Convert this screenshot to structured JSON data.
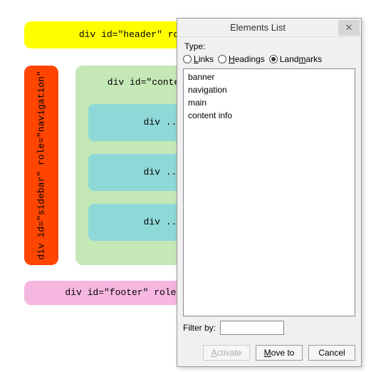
{
  "layout": {
    "header": "div id=\"header\" role=\"banner\"",
    "sidebar": "div id=\"sidebar\" role=\"navigation\"",
    "content": "div id=\"content\" role=\"main\"",
    "sub": "div ... role=\"\"",
    "footer": "div id=\"footer\" role=\"contentinfo\""
  },
  "dialog": {
    "title": "Elements List",
    "type_label": "Type:",
    "radios": {
      "links": "Links",
      "headings": "Headings",
      "landmarks": "Landmarks",
      "selected": "landmarks"
    },
    "list": [
      "banner",
      "navigation",
      "main",
      "content info"
    ],
    "filter_label": "Filter by:",
    "filter_value": "",
    "buttons": {
      "activate": "Activate",
      "moveto": "Move to",
      "cancel": "Cancel"
    }
  }
}
